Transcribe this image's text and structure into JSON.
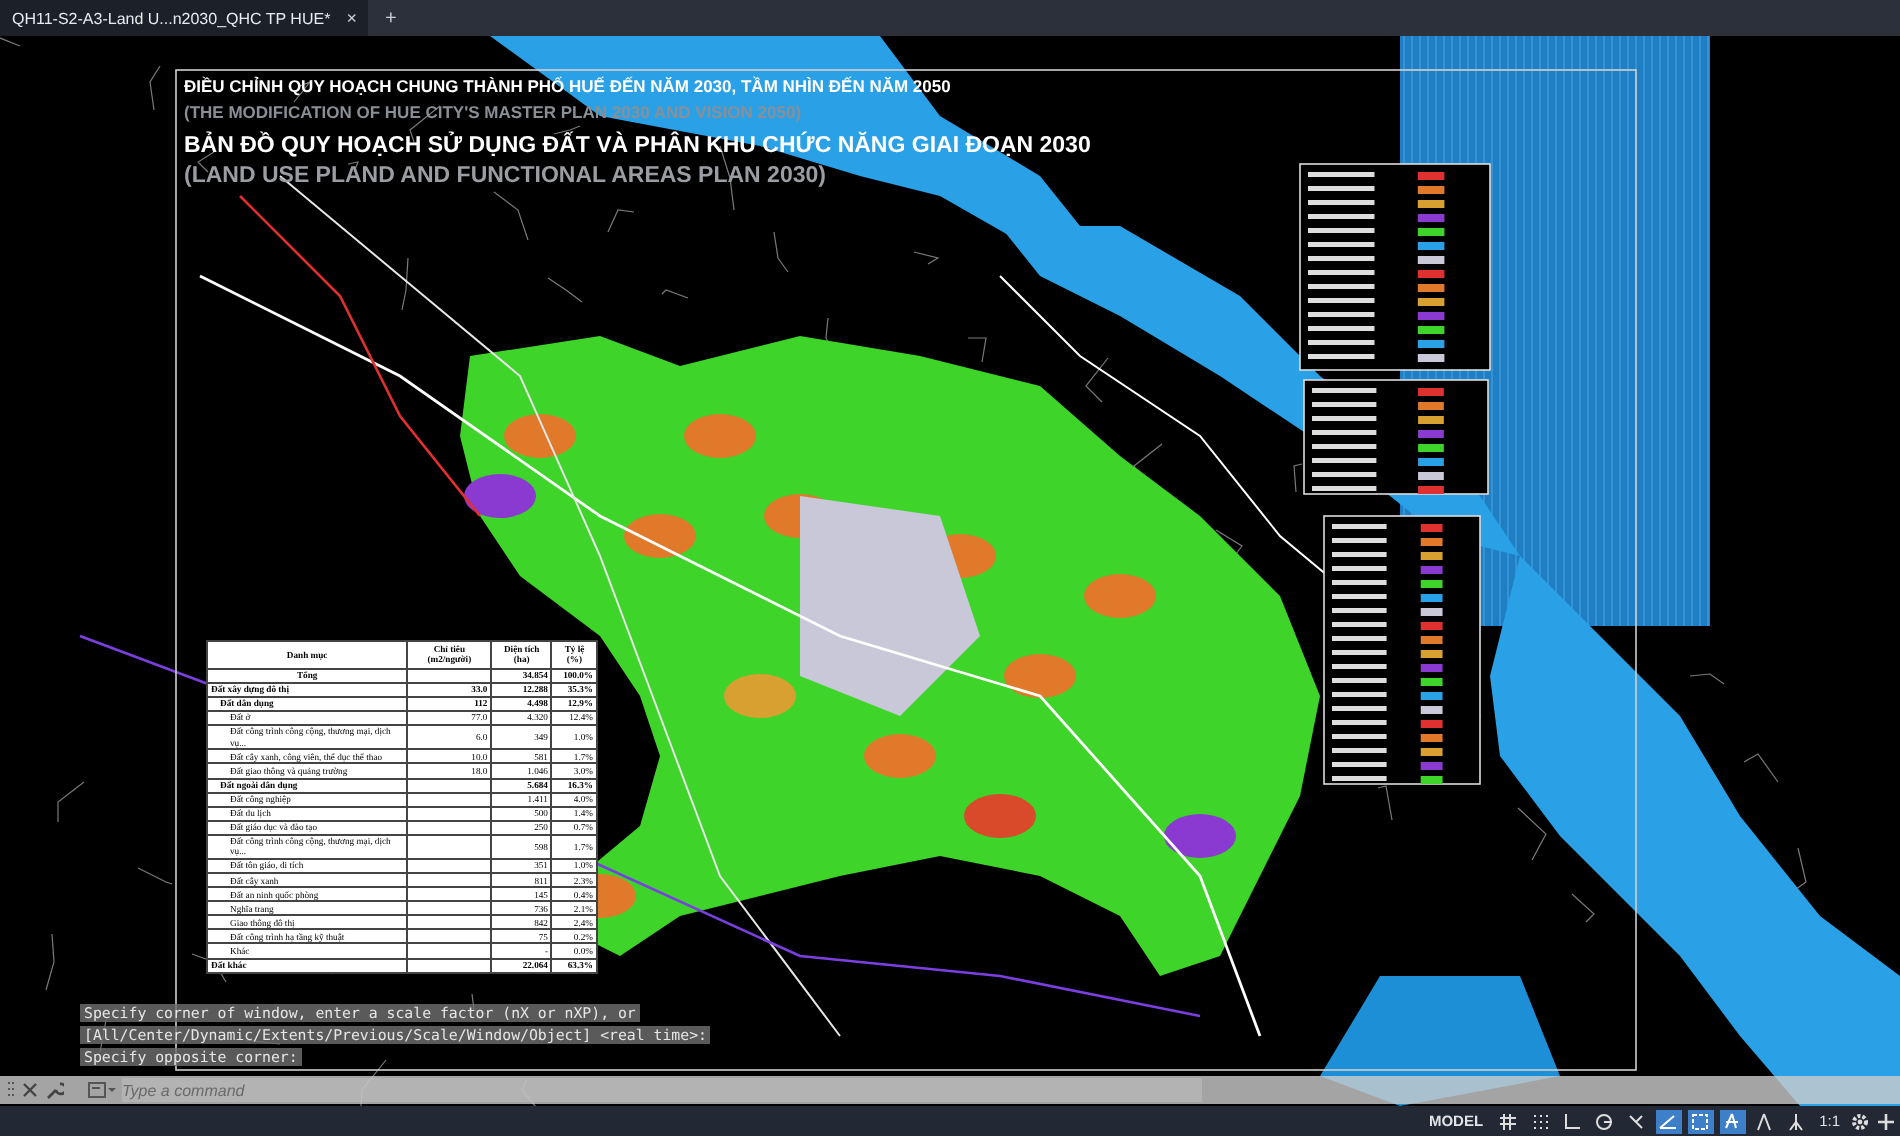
{
  "tabs": [
    {
      "label": "QH11-S2-A3-Land U...n2030_QHC TP HUE*",
      "selected": true,
      "close": "×"
    }
  ],
  "new_tab": "+",
  "drawing": {
    "titles": [
      {
        "kind": "main",
        "text": "ĐIỀU CHỈNH QUY HOẠCH CHUNG THÀNH PHỐ HUẾ ĐẾN NĂM 2030, TẦM NHÌN ĐẾN NĂM 2050"
      },
      {
        "kind": "sub",
        "text": "(THE MODIFICATION OF HUE CITY'S MASTER PLAN 2030 AND VISION 2050)"
      },
      {
        "kind": "heading",
        "text": "BẢN ĐỒ QUY HOẠCH SỬ DỤNG ĐẤT VÀ PHÂN KHU CHỨC NĂNG GIAI ĐOẠN 2030"
      },
      {
        "kind": "subheading",
        "text": "(LAND USE PLAND AND FUNCTIONAL AREAS PLAN 2030)"
      }
    ],
    "table": {
      "columns": [
        "Danh mục",
        "Chỉ tiêu (m2/người)",
        "Diện tích (ha)",
        "Tỷ lệ (%)"
      ],
      "rows": [
        {
          "kind": "total",
          "cells": [
            "Tổng",
            "",
            "34.854",
            "100.0%"
          ]
        },
        {
          "kind": "group",
          "cells": [
            "Đất xây dựng đô thị",
            "33.0",
            "12.288",
            "35.3%"
          ]
        },
        {
          "kind": "subgroup",
          "cells": [
            "Đất dân dụng",
            "112",
            "4.498",
            "12.9%"
          ]
        },
        {
          "kind": "item",
          "cells": [
            "Đất ở",
            "77.0",
            "4.320",
            "12.4%"
          ]
        },
        {
          "kind": "item",
          "cells": [
            "Đất công trình công cộng, thương mại, dịch vụ...",
            "6.0",
            "349",
            "1.0%"
          ]
        },
        {
          "kind": "item",
          "cells": [
            "Đất cây xanh, công viên, thể dục thể thao",
            "10.0",
            "581",
            "1.7%"
          ]
        },
        {
          "kind": "item",
          "cells": [
            "Đất giao thông và quảng trường",
            "18.0",
            "1.046",
            "3.0%"
          ]
        },
        {
          "kind": "subgroup",
          "cells": [
            "Đất ngoài dân dụng",
            "",
            "5.684",
            "16.3%"
          ]
        },
        {
          "kind": "item",
          "cells": [
            "Đất công nghiệp",
            "",
            "1.411",
            "4.0%"
          ]
        },
        {
          "kind": "item",
          "cells": [
            "Đất du lịch",
            "",
            "500",
            "1.4%"
          ]
        },
        {
          "kind": "item",
          "cells": [
            "Đất giáo dục và đào tạo",
            "",
            "250",
            "0.7%"
          ]
        },
        {
          "kind": "item",
          "cells": [
            "Đất công trình công cộng, thương mại, dịch vụ...",
            "",
            "598",
            "1.7%"
          ]
        },
        {
          "kind": "item",
          "cells": [
            "Đất tôn giáo, di tích",
            "",
            "351",
            "1.0%"
          ]
        },
        {
          "kind": "item",
          "cells": [
            "Đất cây xanh",
            "",
            "811",
            "2.3%"
          ]
        },
        {
          "kind": "item",
          "cells": [
            "Đất an ninh quốc phòng",
            "",
            "145",
            "0.4%"
          ]
        },
        {
          "kind": "item",
          "cells": [
            "Nghĩa trang",
            "",
            "736",
            "2.1%"
          ]
        },
        {
          "kind": "item",
          "cells": [
            "Giao thông đô thị",
            "",
            "842",
            "2.4%"
          ]
        },
        {
          "kind": "item",
          "cells": [
            "Đất công trình hạ tầng kỹ thuật",
            "",
            "75",
            "0.2%"
          ]
        },
        {
          "kind": "item",
          "cells": [
            "Khác",
            "",
            "-",
            "0.0%"
          ]
        },
        {
          "kind": "group",
          "cells": [
            "Đất khác",
            "",
            "22.064",
            "63.3%"
          ]
        }
      ]
    }
  },
  "command_history": [
    "Specify corner of window, enter a scale factor (nX or nXP), or",
    "[All/Center/Dynamic/Extents/Previous/Scale/Window/Object] <real time>:",
    "Specify opposite corner:"
  ],
  "command_line": {
    "placeholder": "Type a command"
  },
  "status_bar": {
    "model": "MODEL",
    "scale": "1:1",
    "toggles": [
      {
        "kind": "grid",
        "on": false
      },
      {
        "kind": "snap",
        "on": false
      },
      {
        "kind": "ortho",
        "on": false
      },
      {
        "kind": "polar",
        "on": false
      },
      {
        "kind": "osnap",
        "on": false
      },
      {
        "kind": "angle",
        "on": true
      },
      {
        "kind": "select",
        "on": true
      },
      {
        "kind": "annovis",
        "on": true
      },
      {
        "kind": "autoscale",
        "on": false
      },
      {
        "kind": "annoscale",
        "on": false
      }
    ]
  }
}
